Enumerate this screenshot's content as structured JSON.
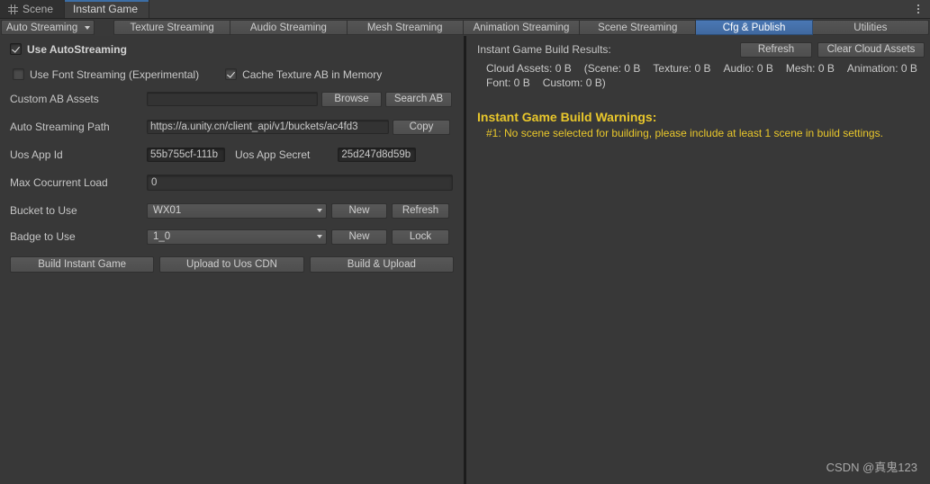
{
  "window": {
    "tabs": [
      {
        "label": "Scene",
        "icon": "grid-icon",
        "active": false
      },
      {
        "label": "Instant Game",
        "icon": "",
        "active": true
      }
    ],
    "menu_icon": "kebab-menu-icon"
  },
  "toolbar": {
    "mode_dropdown": "Auto Streaming",
    "tabs": [
      {
        "label": "Texture Streaming",
        "selected": false
      },
      {
        "label": "Audio Streaming",
        "selected": false
      },
      {
        "label": "Mesh Streaming",
        "selected": false
      },
      {
        "label": "Animation Streaming",
        "selected": false
      },
      {
        "label": "Scene Streaming",
        "selected": false
      },
      {
        "label": "Cfg & Publish",
        "selected": true
      },
      {
        "label": "Utilities",
        "selected": false
      }
    ]
  },
  "settings": {
    "use_autostreaming": {
      "label": "Use AutoStreaming",
      "checked": true
    },
    "use_font_streaming": {
      "label": "Use Font Streaming (Experimental)",
      "checked": false
    },
    "cache_texture_ab": {
      "label": "Cache Texture AB in Memory",
      "checked": true
    },
    "custom_ab_assets": {
      "label": "Custom AB Assets",
      "value": "",
      "browse_label": "Browse",
      "search_label": "Search AB"
    },
    "auto_streaming_path": {
      "label": "Auto Streaming Path",
      "value": "https://a.unity.cn/client_api/v1/buckets/ac4fd3",
      "copy_label": "Copy"
    },
    "uos_app_id": {
      "label": "Uos App Id",
      "value": "55b755cf-111b"
    },
    "uos_app_secret": {
      "label": "Uos App Secret",
      "value": "25d247d8d59b"
    },
    "max_cocurrent_load": {
      "label": "Max Cocurrent Load",
      "value": "0"
    },
    "bucket_to_use": {
      "label": "Bucket to Use",
      "value": "WX01",
      "new_label": "New",
      "refresh_label": "Refresh"
    },
    "badge_to_use": {
      "label": "Badge to Use",
      "value": "1_0",
      "new_label": "New",
      "lock_label": "Lock"
    }
  },
  "actions": {
    "build": "Build Instant Game",
    "upload": "Upload to Uos CDN",
    "build_upload": "Build & Upload"
  },
  "results": {
    "title": "Instant Game Build Results:",
    "refresh_label": "Refresh",
    "clear_label": "Clear Cloud Assets",
    "line1": [
      "Cloud Assets:  0 B",
      "(Scene: 0 B",
      "Texture: 0 B",
      "Audio: 0 B",
      "Mesh: 0 B",
      "Animation: 0 B"
    ],
    "line2": [
      "Font: 0 B",
      "Custom: 0 B)"
    ]
  },
  "warnings": {
    "title": "Instant Game Build Warnings:",
    "items": [
      "#1: No scene selected for building, please include at least 1 scene in build settings."
    ]
  },
  "watermark": "CSDN @真鬼123",
  "colors": {
    "accent_blue": "#4a78b4",
    "warning_yellow": "#e9c72b",
    "background": "#383838"
  }
}
